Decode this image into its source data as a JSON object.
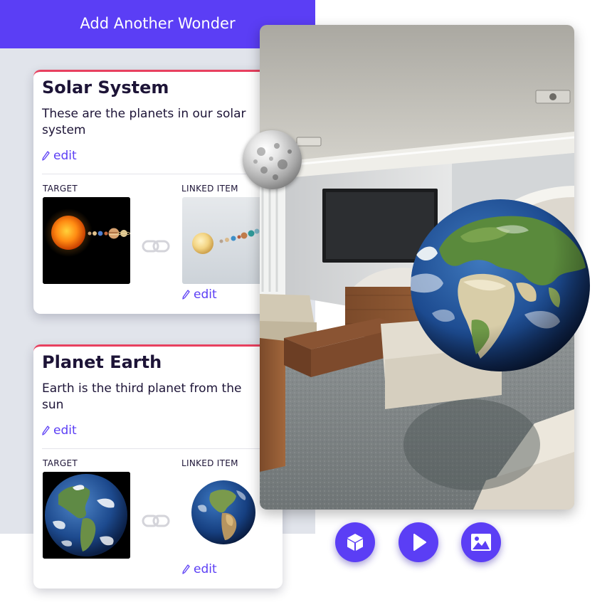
{
  "header": {
    "add_button_label": "Add Another Wonder"
  },
  "labels": {
    "target": "TARGET",
    "linked_item": "LINKED ITEM",
    "edit": "edit"
  },
  "wonders": [
    {
      "title": "Solar System",
      "description": "These are the planets in our solar system"
    },
    {
      "title": "Planet Earth",
      "description": "Earth is the third planet from the sun"
    }
  ],
  "icons": {
    "edit": "pencil-icon",
    "link": "chain-link-icon",
    "model": "cube-icon",
    "video": "play-icon",
    "image": "image-icon"
  },
  "colors": {
    "accent": "#5b3ef5",
    "card_top_border": "#e8405f",
    "panel_background": "#e1e4eb",
    "heading_text": "#1d1437"
  }
}
